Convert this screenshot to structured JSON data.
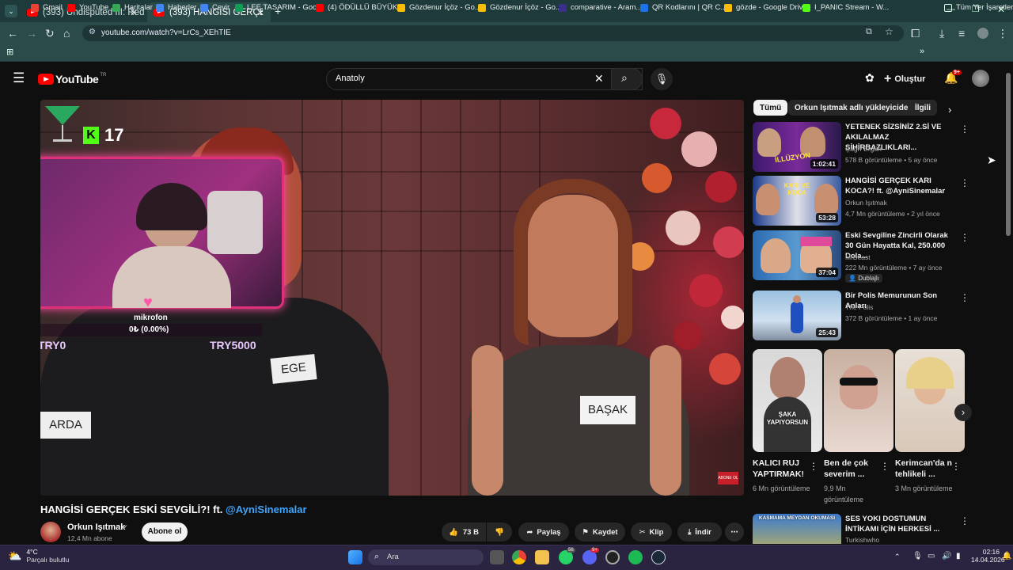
{
  "browser": {
    "tabs": [
      {
        "title": "(393) Undisputed III: Redemptio"
      },
      {
        "title": "(393) HANGİSİ GERÇEK ESKİ SEV"
      }
    ],
    "new_tab_symbol": "+",
    "url": "youtube.com/watch?v=LrCs_XEhTIE",
    "bookmarks": [
      {
        "label": "Gmail",
        "color": "#ea4335"
      },
      {
        "label": "YouTube",
        "color": "#ff0000"
      },
      {
        "label": "Haritalar",
        "color": "#34a853"
      },
      {
        "label": "Haberler",
        "color": "#4285f4"
      },
      {
        "label": "Çevir",
        "color": "#4285f4"
      },
      {
        "label": "LEE TASARIM - Goo...",
        "color": "#0f9d58"
      },
      {
        "label": "(4) ÖDÜLLÜ BÜYÜK...",
        "color": "#ff0000"
      },
      {
        "label": "Gözdenur İçöz - Go...",
        "color": "#fbbc04"
      },
      {
        "label": "Gözdenur İçöz - Go...",
        "color": "#fbbc04"
      },
      {
        "label": "comparative - Aram...",
        "color": "#3b2e8c"
      },
      {
        "label": "QR Kodlarını | QR C...",
        "color": "#1a73e8"
      },
      {
        "label": "gözde - Google Drive",
        "color": "#fbbc04"
      },
      {
        "label": "I_PANIC Stream - W...",
        "color": "#53fc18"
      }
    ],
    "more_bookmarks": "»",
    "all_bookmarks": "Tüm Yer İşaretleri"
  },
  "youtube": {
    "logo_text": "YouTube",
    "logo_sup": "TR",
    "search_query": "Anatoly",
    "create_label": "Oluştur",
    "notif_count": "9+"
  },
  "video": {
    "title_main": "HANGİSİ GERÇEK ESKİ SEVGİLİ?! ft. ",
    "title_mention": "@AyniSinemalar",
    "channel_name": "Orkun Işıtmak",
    "subscribers": "12,4 Mn abone",
    "subscribe_label": "Abone ol",
    "likes": "73 B",
    "share_label": "Paylaş",
    "save_label": "Kaydet",
    "clip_label": "Klip",
    "download_label": "İndir",
    "overlay": {
      "kick_count": "17",
      "mic_label": "mikrofon",
      "mic_value": "0₺ (0.00%)",
      "try_low": "TRY0",
      "try_high": "TRY5000",
      "name_tag_1": "EGE",
      "name_tag_2": "BAŞAK",
      "name_tag_3": "ARDA",
      "subscribe_badge": "ABONE OL"
    }
  },
  "sidebar": {
    "chips": [
      "Tümü",
      "Orkun Işıtmak adlı yükleyiciden",
      "İlgili"
    ],
    "recommendations": [
      {
        "title": "YETENEK SİZSİNİZ 2.Sİ VE AKILALMAZ SİHİRBAZLIKLARI...",
        "channel": "Çağrı Ergün",
        "meta": "578 B görüntüleme • 5 ay önce",
        "duration": "1:02:41",
        "thumb_text": "İLLÜZYON"
      },
      {
        "title": "HANGİSİ GERÇEK KARI KOCA?! ft. @AyniSinemalar",
        "channel": "Orkun Işıtmak",
        "meta": "4,7 Mn görüntüleme • 2 yıl önce",
        "duration": "53:28",
        "thumb_text": "KARI VE KOCA"
      },
      {
        "title": "Eski Sevgiline Zincirli Olarak 30 Gün Hayatta Kal, 250.000 Dola...",
        "channel": "MrBeast",
        "meta": "222 Mn görüntüleme • 7 ay önce",
        "duration": "37:04",
        "badge": "Dublajlı"
      },
      {
        "title": "Bir Polis Memurunun Son Anları",
        "channel": "The Polis",
        "meta": "372 B görüntüleme • 1 ay önce",
        "duration": "25:43"
      }
    ],
    "shorts": [
      {
        "title": "KALICI RUJ YAPTIRMAK!",
        "views": "6 Mn görüntüleme",
        "thumb_text": "ŞAKA YAPIYORSUN"
      },
      {
        "title": "Ben de çok severim ...",
        "views": "9,9 Mn görüntüleme"
      },
      {
        "title": "Kerimcan'da n tehlikeli ...",
        "views": "3 Mn görüntüleme"
      }
    ],
    "bottom_rec": {
      "title": "SES YOKI DOSTUMUN İNTİKAMI İÇİN HERKESİ ...",
      "channel": "Turkishwho",
      "thumb_text": "KASMAMA MEYDAN OKUMASI"
    }
  },
  "taskbar": {
    "weather_temp": "4°C",
    "weather_desc": "Parçalı bulutlu",
    "search_placeholder": "Ara",
    "time": "02:16",
    "date": "14.04.2026",
    "badges": {
      "whatsapp": "56",
      "discord": "9+"
    }
  }
}
